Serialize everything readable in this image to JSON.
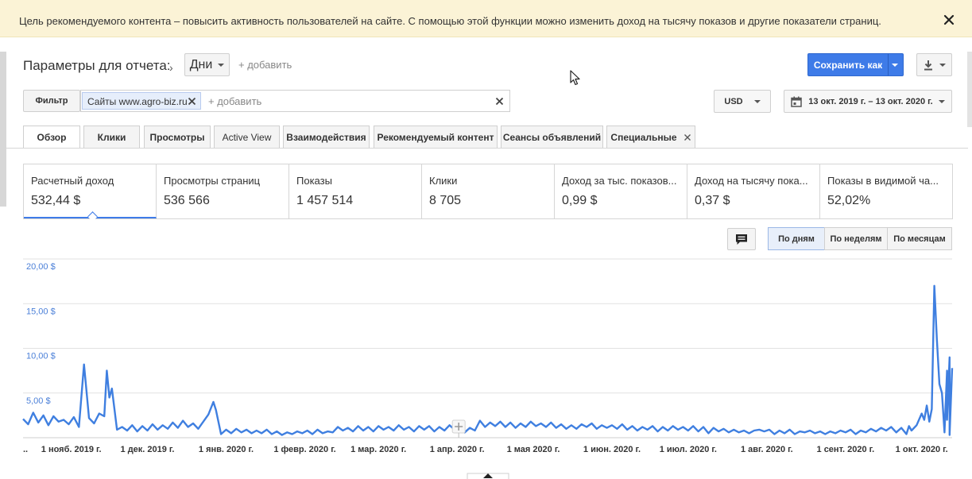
{
  "banner": {
    "text": "Цель рекомендуемого контента – повысить активность пользователей на сайте. С помощью этой функции можно изменить доход на тысячу показов и другие показатели страниц."
  },
  "toolbar": {
    "params_label": "Параметры для отчета:",
    "dimension": "Дни",
    "add_dimension": "+ добавить",
    "save_label": "Сохранить как"
  },
  "filter": {
    "button": "Фильтр",
    "chip": "Сайты www.agro-biz.ru",
    "add": "+ добавить"
  },
  "currency": "USD",
  "date_range": "13 окт. 2019 г. – 13 окт. 2020 г.",
  "tabs": [
    {
      "label": "Обзор",
      "active": true
    },
    {
      "label": "Клики"
    },
    {
      "label": "Просмотры"
    },
    {
      "label": "Active View"
    },
    {
      "label": "Взаимодействия"
    },
    {
      "label": "Рекомендуемый контент"
    },
    {
      "label": "Сеансы объявлений"
    },
    {
      "label": "Специальные"
    }
  ],
  "metrics": [
    {
      "label": "Расчетный доход",
      "value": "532,44 $"
    },
    {
      "label": "Просмотры страниц",
      "value": "536 566"
    },
    {
      "label": "Показы",
      "value": "1 457 514"
    },
    {
      "label": "Клики",
      "value": "8 705"
    },
    {
      "label": "Доход за тыс. показов...",
      "value": "0,99 $"
    },
    {
      "label": "Доход на тысячу пока...",
      "value": "0,37 $"
    },
    {
      "label": "Показы в видимой ча...",
      "value": "52,02%"
    }
  ],
  "period": {
    "days": "По дням",
    "weeks": "По неделям",
    "months": "По месяцам",
    "active": "days"
  },
  "colors": {
    "accent": "#3e7be8",
    "line": "#3f7fe0",
    "banner_bg": "#fbf3d6"
  },
  "chart_data": {
    "type": "line",
    "title": "",
    "xlabel": "",
    "ylabel": "",
    "ylim": [
      0,
      20
    ],
    "yticks": [
      {
        "value": 20,
        "label": "20,00 $"
      },
      {
        "value": 15,
        "label": "15,00 $"
      },
      {
        "value": 10,
        "label": "10,00 $"
      },
      {
        "value": 5,
        "label": "5,00 $"
      }
    ],
    "x_range": [
      "2019-10-13",
      "2020-10-13"
    ],
    "x_ticks": [
      {
        "date": "2019-10-13",
        "label": ".."
      },
      {
        "date": "2019-11-01",
        "label": "1 нояб. 2019 г."
      },
      {
        "date": "2019-12-01",
        "label": "1 дек. 2019 г."
      },
      {
        "date": "2020-01-01",
        "label": "1 янв. 2020 г."
      },
      {
        "date": "2020-02-01",
        "label": "1 февр. 2020 г."
      },
      {
        "date": "2020-03-01",
        "label": "1 мар. 2020 г."
      },
      {
        "date": "2020-04-01",
        "label": "1 апр. 2020 г."
      },
      {
        "date": "2020-05-01",
        "label": "1 мая 2020 г."
      },
      {
        "date": "2020-06-01",
        "label": "1 июн. 2020 г."
      },
      {
        "date": "2020-07-01",
        "label": "1 июл. 2020 г."
      },
      {
        "date": "2020-08-01",
        "label": "1 авг. 2020 г."
      },
      {
        "date": "2020-09-01",
        "label": "1 сент. 2020 г."
      },
      {
        "date": "2020-10-01",
        "label": "1 окт. 2020 г."
      }
    ],
    "series": [
      {
        "points": [
          [
            "2019-10-13",
            2.1
          ],
          [
            "2019-10-15",
            1.5
          ],
          [
            "2019-10-17",
            2.8
          ],
          [
            "2019-10-19",
            1.7
          ],
          [
            "2019-10-21",
            2.5
          ],
          [
            "2019-10-23",
            1.4
          ],
          [
            "2019-10-25",
            2.4
          ],
          [
            "2019-10-27",
            1.8
          ],
          [
            "2019-10-29",
            2.0
          ],
          [
            "2019-10-31",
            1.5
          ],
          [
            "2019-11-02",
            2.3
          ],
          [
            "2019-11-04",
            1.2
          ],
          [
            "2019-11-06",
            8.2
          ],
          [
            "2019-11-08",
            2.2
          ],
          [
            "2019-11-10",
            1.6
          ],
          [
            "2019-11-12",
            2.7
          ],
          [
            "2019-11-14",
            2.4
          ],
          [
            "2019-11-15",
            7.5
          ],
          [
            "2019-11-16",
            4.5
          ],
          [
            "2019-11-17",
            5.5
          ],
          [
            "2019-11-19",
            0.9
          ],
          [
            "2019-11-21",
            1.2
          ],
          [
            "2019-11-23",
            0.8
          ],
          [
            "2019-11-25",
            1.4
          ],
          [
            "2019-11-27",
            0.7
          ],
          [
            "2019-11-29",
            1.3
          ],
          [
            "2019-12-01",
            0.8
          ],
          [
            "2019-12-03",
            1.5
          ],
          [
            "2019-12-05",
            0.9
          ],
          [
            "2019-12-07",
            1.4
          ],
          [
            "2019-12-09",
            1.0
          ],
          [
            "2019-12-11",
            1.7
          ],
          [
            "2019-12-13",
            1.1
          ],
          [
            "2019-12-15",
            1.9
          ],
          [
            "2019-12-17",
            1.2
          ],
          [
            "2019-12-19",
            1.6
          ],
          [
            "2019-12-21",
            1.0
          ],
          [
            "2019-12-23",
            1.8
          ],
          [
            "2019-12-25",
            2.6
          ],
          [
            "2019-12-27",
            4.0
          ],
          [
            "2019-12-28",
            3.1
          ],
          [
            "2019-12-30",
            0.4
          ],
          [
            "2020-01-01",
            0.9
          ],
          [
            "2020-01-03",
            0.5
          ],
          [
            "2020-01-05",
            1.0
          ],
          [
            "2020-01-07",
            0.6
          ],
          [
            "2020-01-09",
            0.9
          ],
          [
            "2020-01-11",
            0.5
          ],
          [
            "2020-01-13",
            0.8
          ],
          [
            "2020-01-15",
            0.5
          ],
          [
            "2020-01-17",
            0.9
          ],
          [
            "2020-01-19",
            0.4
          ],
          [
            "2020-01-21",
            0.7
          ],
          [
            "2020-01-23",
            0.3
          ],
          [
            "2020-01-25",
            0.6
          ],
          [
            "2020-01-27",
            0.4
          ],
          [
            "2020-01-29",
            0.7
          ],
          [
            "2020-01-31",
            0.5
          ],
          [
            "2020-02-02",
            0.8
          ],
          [
            "2020-02-04",
            0.4
          ],
          [
            "2020-02-06",
            0.9
          ],
          [
            "2020-02-08",
            0.5
          ],
          [
            "2020-02-10",
            0.7
          ],
          [
            "2020-02-12",
            0.6
          ],
          [
            "2020-02-14",
            1.2
          ],
          [
            "2020-02-16",
            0.8
          ],
          [
            "2020-02-18",
            1.1
          ],
          [
            "2020-02-20",
            0.7
          ],
          [
            "2020-02-22",
            1.3
          ],
          [
            "2020-02-24",
            0.8
          ],
          [
            "2020-02-26",
            1.2
          ],
          [
            "2020-02-28",
            0.7
          ],
          [
            "2020-03-01",
            1.3
          ],
          [
            "2020-03-03",
            0.9
          ],
          [
            "2020-03-05",
            1.2
          ],
          [
            "2020-03-07",
            0.8
          ],
          [
            "2020-03-09",
            1.4
          ],
          [
            "2020-03-11",
            0.9
          ],
          [
            "2020-03-13",
            1.2
          ],
          [
            "2020-03-15",
            0.7
          ],
          [
            "2020-03-17",
            1.3
          ],
          [
            "2020-03-19",
            0.9
          ],
          [
            "2020-03-21",
            1.3
          ],
          [
            "2020-03-23",
            0.7
          ],
          [
            "2020-03-25",
            1.2
          ],
          [
            "2020-03-27",
            0.8
          ],
          [
            "2020-03-29",
            1.4
          ],
          [
            "2020-03-31",
            0.9
          ],
          [
            "2020-04-02",
            1.2
          ],
          [
            "2020-04-04",
            0.6
          ],
          [
            "2020-04-06",
            1.1
          ],
          [
            "2020-04-08",
            0.8
          ],
          [
            "2020-04-10",
            1.9
          ],
          [
            "2020-04-12",
            1.2
          ],
          [
            "2020-04-14",
            1.7
          ],
          [
            "2020-04-16",
            1.3
          ],
          [
            "2020-04-18",
            1.8
          ],
          [
            "2020-04-20",
            1.2
          ],
          [
            "2020-04-22",
            1.7
          ],
          [
            "2020-04-24",
            1.1
          ],
          [
            "2020-04-26",
            1.6
          ],
          [
            "2020-04-28",
            1.2
          ],
          [
            "2020-04-30",
            1.8
          ],
          [
            "2020-05-02",
            1.3
          ],
          [
            "2020-05-04",
            1.6
          ],
          [
            "2020-05-06",
            1.2
          ],
          [
            "2020-05-08",
            1.7
          ],
          [
            "2020-05-10",
            1.1
          ],
          [
            "2020-05-12",
            1.5
          ],
          [
            "2020-05-14",
            1.0
          ],
          [
            "2020-05-16",
            1.4
          ],
          [
            "2020-05-18",
            1.0
          ],
          [
            "2020-05-20",
            1.5
          ],
          [
            "2020-05-22",
            1.2
          ],
          [
            "2020-05-24",
            1.6
          ],
          [
            "2020-05-26",
            1.0
          ],
          [
            "2020-05-28",
            1.4
          ],
          [
            "2020-05-30",
            1.1
          ],
          [
            "2020-06-01",
            1.4
          ],
          [
            "2020-06-03",
            1.0
          ],
          [
            "2020-06-05",
            1.5
          ],
          [
            "2020-06-07",
            0.9
          ],
          [
            "2020-06-09",
            1.3
          ],
          [
            "2020-06-11",
            0.8
          ],
          [
            "2020-06-13",
            1.2
          ],
          [
            "2020-06-15",
            0.9
          ],
          [
            "2020-06-17",
            1.3
          ],
          [
            "2020-06-19",
            0.7
          ],
          [
            "2020-06-21",
            1.2
          ],
          [
            "2020-06-23",
            0.8
          ],
          [
            "2020-06-25",
            1.3
          ],
          [
            "2020-06-27",
            0.9
          ],
          [
            "2020-06-29",
            1.2
          ],
          [
            "2020-07-01",
            0.8
          ],
          [
            "2020-07-03",
            1.3
          ],
          [
            "2020-07-05",
            0.7
          ],
          [
            "2020-07-07",
            1.2
          ],
          [
            "2020-07-09",
            0.5
          ],
          [
            "2020-07-11",
            1.1
          ],
          [
            "2020-07-13",
            0.7
          ],
          [
            "2020-07-15",
            1.0
          ],
          [
            "2020-07-17",
            0.6
          ],
          [
            "2020-07-19",
            0.9
          ],
          [
            "2020-07-21",
            0.6
          ],
          [
            "2020-07-23",
            0.8
          ],
          [
            "2020-07-25",
            0.5
          ],
          [
            "2020-07-27",
            0.8
          ],
          [
            "2020-07-29",
            0.9
          ],
          [
            "2020-07-31",
            0.7
          ],
          [
            "2020-08-02",
            0.9
          ],
          [
            "2020-08-04",
            0.4
          ],
          [
            "2020-08-06",
            0.8
          ],
          [
            "2020-08-08",
            0.5
          ],
          [
            "2020-08-10",
            0.9
          ],
          [
            "2020-08-12",
            0.4
          ],
          [
            "2020-08-14",
            0.7
          ],
          [
            "2020-08-16",
            0.6
          ],
          [
            "2020-08-18",
            0.8
          ],
          [
            "2020-08-20",
            0.5
          ],
          [
            "2020-08-22",
            0.7
          ],
          [
            "2020-08-24",
            0.4
          ],
          [
            "2020-08-26",
            0.7
          ],
          [
            "2020-08-28",
            0.5
          ],
          [
            "2020-08-30",
            0.8
          ],
          [
            "2020-09-01",
            0.6
          ],
          [
            "2020-09-03",
            0.9
          ],
          [
            "2020-09-05",
            0.4
          ],
          [
            "2020-09-07",
            0.8
          ],
          [
            "2020-09-09",
            0.6
          ],
          [
            "2020-09-11",
            1.0
          ],
          [
            "2020-09-13",
            0.7
          ],
          [
            "2020-09-15",
            1.1
          ],
          [
            "2020-09-17",
            0.8
          ],
          [
            "2020-09-19",
            1.2
          ],
          [
            "2020-09-21",
            0.6
          ],
          [
            "2020-09-23",
            1.1
          ],
          [
            "2020-09-25",
            0.4
          ],
          [
            "2020-09-26",
            1.3
          ],
          [
            "2020-09-27",
            0.8
          ],
          [
            "2020-09-29",
            1.4
          ],
          [
            "2020-10-01",
            2.7
          ],
          [
            "2020-10-02",
            2.0
          ],
          [
            "2020-10-03",
            3.6
          ],
          [
            "2020-10-04",
            1.8
          ],
          [
            "2020-10-05",
            3.2
          ],
          [
            "2020-10-06",
            17.0
          ],
          [
            "2020-10-07",
            11.0
          ],
          [
            "2020-10-08",
            6.0
          ],
          [
            "2020-10-09",
            5.0
          ],
          [
            "2020-10-10",
            0.6
          ],
          [
            "2020-10-11",
            7.5
          ],
          [
            "2020-10-11",
            2.0
          ],
          [
            "2020-10-12",
            9.0
          ],
          [
            "2020-10-12",
            0.3
          ],
          [
            "2020-10-13",
            7.8
          ]
        ]
      }
    ]
  }
}
